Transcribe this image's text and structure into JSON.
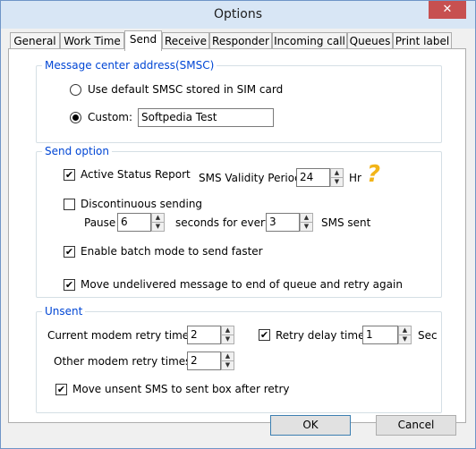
{
  "window": {
    "title": "Options",
    "close_glyph": "✕"
  },
  "tabs": [
    {
      "label": "General"
    },
    {
      "label": "Work Time"
    },
    {
      "label": "Send"
    },
    {
      "label": "Receive"
    },
    {
      "label": "Responder"
    },
    {
      "label": "Incoming call"
    },
    {
      "label": "Queues"
    },
    {
      "label": "Print label"
    }
  ],
  "smsc": {
    "title": "Message center address(SMSC)",
    "default_label": "Use default SMSC stored in SIM card",
    "custom_label": "Custom:",
    "custom_value": "Softpedia Test"
  },
  "send_option": {
    "title": "Send option",
    "active_status_label": "Active Status Report",
    "validity_label": "SMS Validity Period",
    "validity_value": "24",
    "validity_unit": "Hr",
    "discontinuous_label": "Discontinuous sending",
    "pause_label": "Pause",
    "pause_value": "6",
    "seconds_label": "seconds for every",
    "every_value": "3",
    "sms_sent_label": "SMS sent",
    "batch_label": "Enable batch mode to send faster",
    "move_undelivered_label": "Move undelivered message to end of queue and retry again"
  },
  "unsent": {
    "title": "Unsent",
    "current_modem_label": "Current modem retry times",
    "current_modem_value": "2",
    "retry_delay_label": "Retry delay time",
    "retry_delay_value": "1",
    "retry_delay_unit": "Sec",
    "other_modem_label": "Other modem retry times",
    "other_modem_value": "2",
    "move_unsent_label": "Move unsent SMS to sent box after retry"
  },
  "buttons": {
    "ok": "OK",
    "cancel": "Cancel"
  },
  "check_glyph": "✔",
  "spin_up": "▲",
  "spin_down": "▼",
  "help_glyph": "?"
}
